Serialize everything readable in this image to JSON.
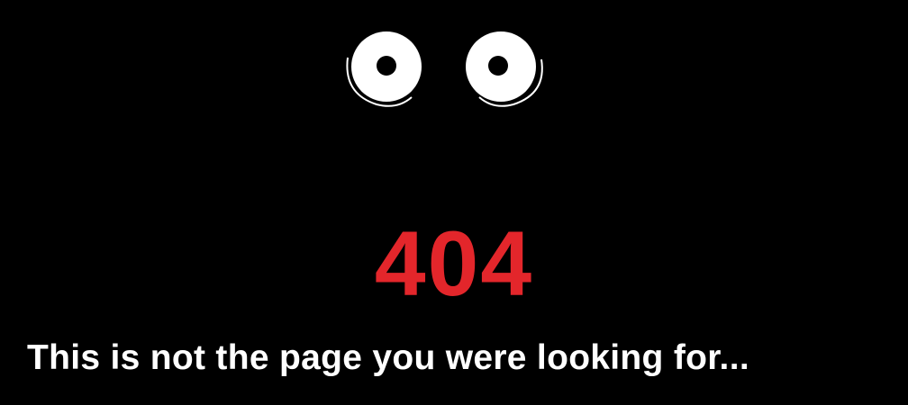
{
  "error": {
    "code": "404",
    "message": "This is not the page you were looking for..."
  },
  "colors": {
    "background": "#000000",
    "code": "#E3262B",
    "message": "#FFFFFF",
    "eye": "#FFFFFF",
    "pupil": "#000000"
  },
  "icons": {
    "left_eye": "eye-icon",
    "right_eye": "eye-icon"
  }
}
